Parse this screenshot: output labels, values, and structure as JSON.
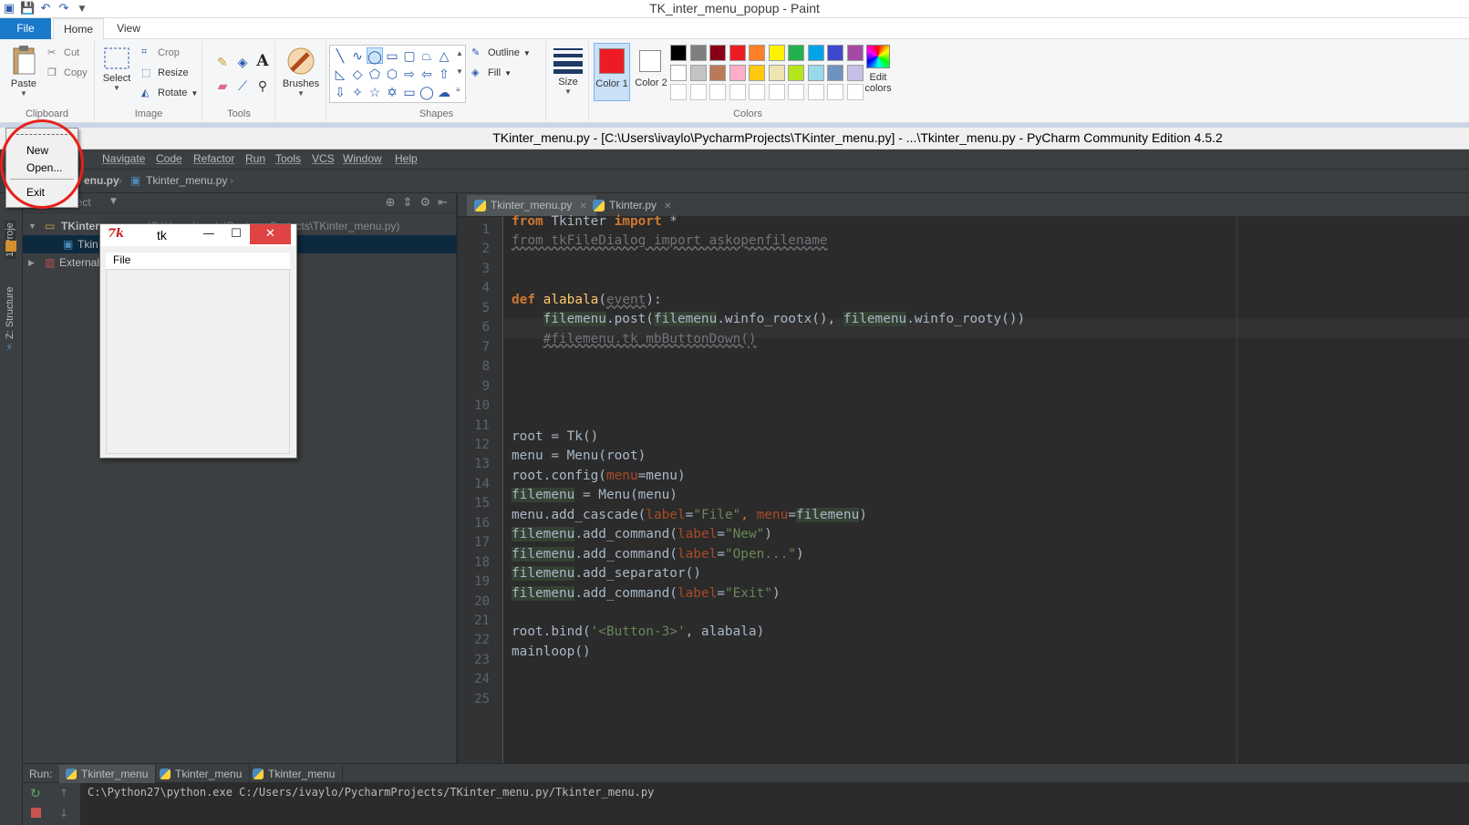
{
  "paint": {
    "title": "TK_inter_menu_popup - Paint",
    "tabs": {
      "file": "File",
      "home": "Home",
      "view": "View"
    },
    "clipboard": {
      "paste": "Paste",
      "cut": "Cut",
      "copy": "Copy",
      "label": "Clipboard"
    },
    "image": {
      "select": "Select",
      "crop": "Crop",
      "resize": "Resize",
      "rotate": "Rotate",
      "label": "Image"
    },
    "tools": {
      "label": "Tools"
    },
    "brushes": {
      "label": "Brushes"
    },
    "shapes": {
      "outline": "Outline",
      "fill": "Fill",
      "label": "Shapes"
    },
    "size": {
      "label": "Size"
    },
    "colors": {
      "color1": "Color 1",
      "color2": "Color 2",
      "edit": "Edit colors",
      "label": "Colors",
      "color1_value": "#ed1c24",
      "color2_value": "#ffffff",
      "row1": [
        "#000000",
        "#7f7f7f",
        "#880015",
        "#ed1c24",
        "#ff7f27",
        "#fff200",
        "#22b14c",
        "#00a2e8",
        "#3f48cc",
        "#a349a4"
      ],
      "row2": [
        "#ffffff",
        "#c3c3c3",
        "#b97a57",
        "#ffaec9",
        "#ffc90e",
        "#efe4b0",
        "#b5e61d",
        "#99d9ea",
        "#7092be",
        "#c8bfe7"
      ],
      "row3": [
        "#ffffff",
        "#ffffff",
        "#ffffff",
        "#ffffff",
        "#ffffff",
        "#ffffff",
        "#ffffff",
        "#ffffff",
        "#ffffff",
        "#ffffff"
      ]
    }
  },
  "pycharm": {
    "title": "TKinter_menu.py - [C:\\Users\\ivaylo\\PycharmProjects\\TKinter_menu.py] - ...\\Tkinter_menu.py - PyCharm Community Edition 4.5.2",
    "menu": [
      "Navigate",
      "Code",
      "Refactor",
      "Run",
      "Tools",
      "VCS",
      "Window",
      "Help"
    ],
    "breadcrumbs": {
      "project": "enu.py",
      "file": "Tkinter_menu.py"
    },
    "side_tabs": {
      "project": "1: Proje",
      "structure": "Z: Structure"
    },
    "project_tree": {
      "root": "TKinter",
      "root_path": "(C:\\Users\\ivaylo\\PycharmProjects\\TKinter_menu.py)",
      "file": "Tkin",
      "external": "External"
    },
    "editor_tabs": [
      "Tkinter_menu.py",
      "Tkinter.py"
    ],
    "line_numbers": [
      "1",
      "2",
      "3",
      "4",
      "5",
      "6",
      "7",
      "8",
      "9",
      "10",
      "11",
      "12",
      "13",
      "14",
      "15",
      "16",
      "17",
      "18",
      "19",
      "20",
      "21",
      "22",
      "23",
      "24",
      "25"
    ],
    "code": {
      "l1": {
        "a": "from",
        "b": " Tkinter ",
        "c": "import",
        "d": " *"
      },
      "l2": "from tkFileDialog import askopenfilename",
      "l5": {
        "a": "def",
        "b": " ",
        "c": "alabala",
        "d": "(",
        "e": "event",
        "f": "):"
      },
      "l6": {
        "indent": "    ",
        "a": "filemenu",
        "b": ".post(",
        "c": "filemenu",
        "d": ".winfo_rootx(), ",
        "e": "filemenu",
        "f": ".winfo_rooty())"
      },
      "l7": {
        "indent": "    ",
        "a": "#filemenu.tk_mbButtonDown()"
      },
      "l12": "root = Tk()",
      "l13": "menu = Menu(root)",
      "l14": {
        "a": "root.config(",
        "b": "menu",
        "c": "=menu)"
      },
      "l15": {
        "a": "filemenu",
        "b": " = Menu(menu)"
      },
      "l16": {
        "a": "menu.add_cascade(",
        "b": "label",
        "c": "=",
        "d": "\"File\"",
        "e": ", ",
        "f": "menu",
        "g": "=",
        "h": "filemenu",
        "i": ")"
      },
      "l17": {
        "a": "filemenu",
        "b": ".add_command(",
        "c": "label",
        "d": "=",
        "e": "\"New\"",
        "f": ")"
      },
      "l18": {
        "a": "filemenu",
        "b": ".add_command(",
        "c": "label",
        "d": "=",
        "e": "\"Open...\"",
        "f": ")"
      },
      "l19": {
        "a": "filemenu",
        "b": ".add_separator()"
      },
      "l20": {
        "a": "filemenu",
        "b": ".add_command(",
        "c": "label",
        "d": "=",
        "e": "\"Exit\"",
        "f": ")"
      },
      "l22": {
        "a": "root.bind(",
        "b": "'<Button-3>'",
        "c": ", alabala)"
      },
      "l23": "mainloop()"
    },
    "run": {
      "label": "Run:",
      "tabs": [
        "Tkinter_menu",
        "Tkinter_menu",
        "Tkinter_menu"
      ],
      "console": "C:\\Python27\\python.exe C:/Users/ivaylo/PycharmProjects/TKinter_menu.py/Tkinter_menu.py"
    }
  },
  "tk": {
    "title": "tk",
    "menu_file": "File",
    "popup": {
      "new": "New",
      "open": "Open...",
      "exit": "Exit"
    }
  }
}
